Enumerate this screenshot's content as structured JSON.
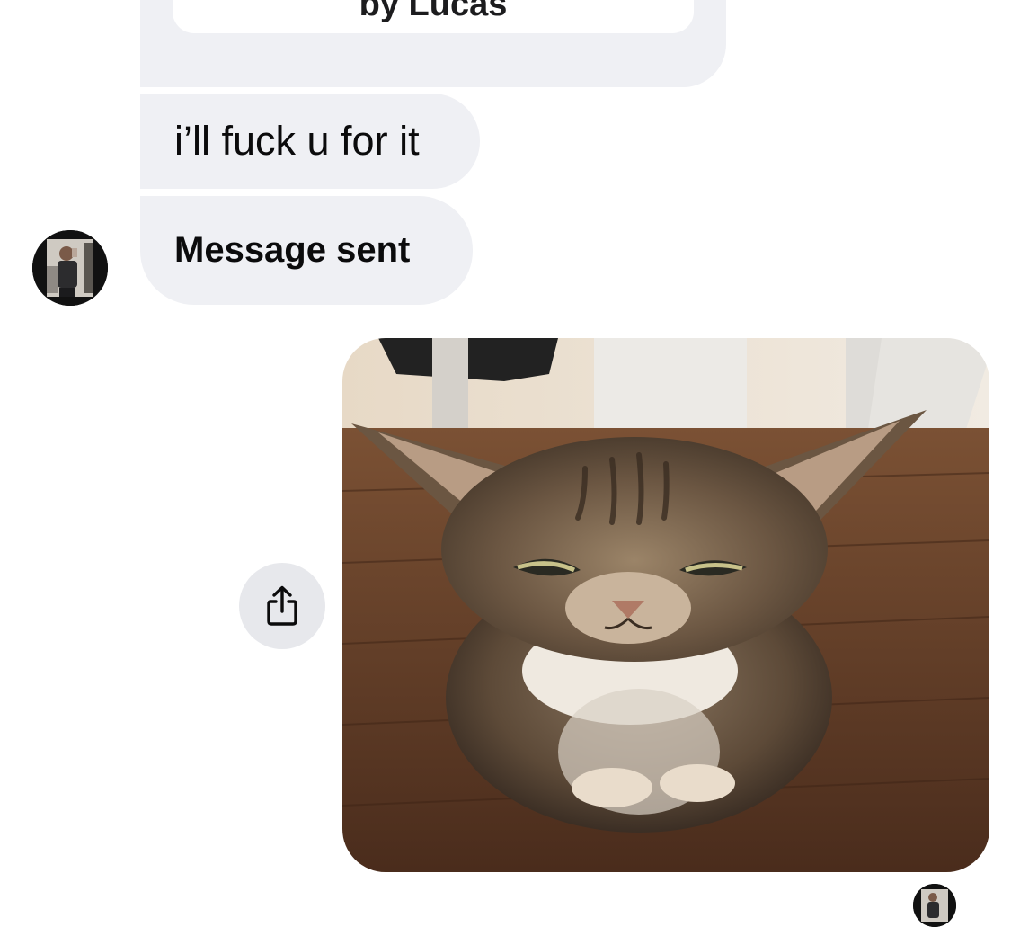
{
  "conversation": {
    "previous_message": {
      "preview_text": "by Lucas"
    },
    "messages": [
      {
        "sender": "other",
        "text": "i’ll fuck u for it"
      },
      {
        "sender": "other",
        "text": "Message sent"
      }
    ],
    "attachment": {
      "type": "photo",
      "sender": "self",
      "subject": "grumpy-tabby-cat"
    }
  },
  "icons": {
    "share": "share-icon",
    "avatar": "avatar"
  },
  "colors": {
    "incoming_bubble": "#eff0f4",
    "share_button_bg": "#e7e8ec",
    "text": "#0b0b0c"
  }
}
